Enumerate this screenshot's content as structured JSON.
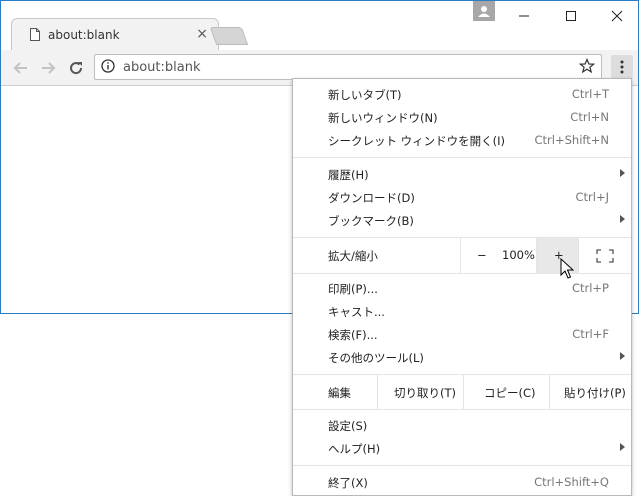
{
  "tab": {
    "title": "about:blank",
    "close": "×"
  },
  "omnibox": {
    "url": "about:blank"
  },
  "menu": {
    "items_group1": [
      {
        "label": "新しいタブ(T)",
        "shortcut": "Ctrl+T"
      },
      {
        "label": "新しいウィンドウ(N)",
        "shortcut": "Ctrl+N"
      },
      {
        "label": "シークレット ウィンドウを開く(I)",
        "shortcut": "Ctrl+Shift+N"
      }
    ],
    "items_group2": [
      {
        "label": "履歴(H)"
      },
      {
        "label": "ダウンロード(D)",
        "shortcut": "Ctrl+J"
      },
      {
        "label": "ブックマーク(B)"
      }
    ],
    "zoom": {
      "label": "拡大/縮小",
      "minus": "−",
      "value": "100%",
      "plus": "+"
    },
    "items_group3": [
      {
        "label": "印刷(P)...",
        "shortcut": "Ctrl+P"
      },
      {
        "label": "キャスト..."
      },
      {
        "label": "検索(F)...",
        "shortcut": "Ctrl+F"
      },
      {
        "label": "その他のツール(L)"
      }
    ],
    "edit": {
      "label": "編集",
      "cut": "切り取り(T)",
      "copy": "コピー(C)",
      "paste": "貼り付け(P)"
    },
    "items_group4": [
      {
        "label": "設定(S)"
      },
      {
        "label": "ヘルプ(H)"
      }
    ],
    "exit": {
      "label": "終了(X)",
      "shortcut": "Ctrl+Shift+Q"
    }
  }
}
